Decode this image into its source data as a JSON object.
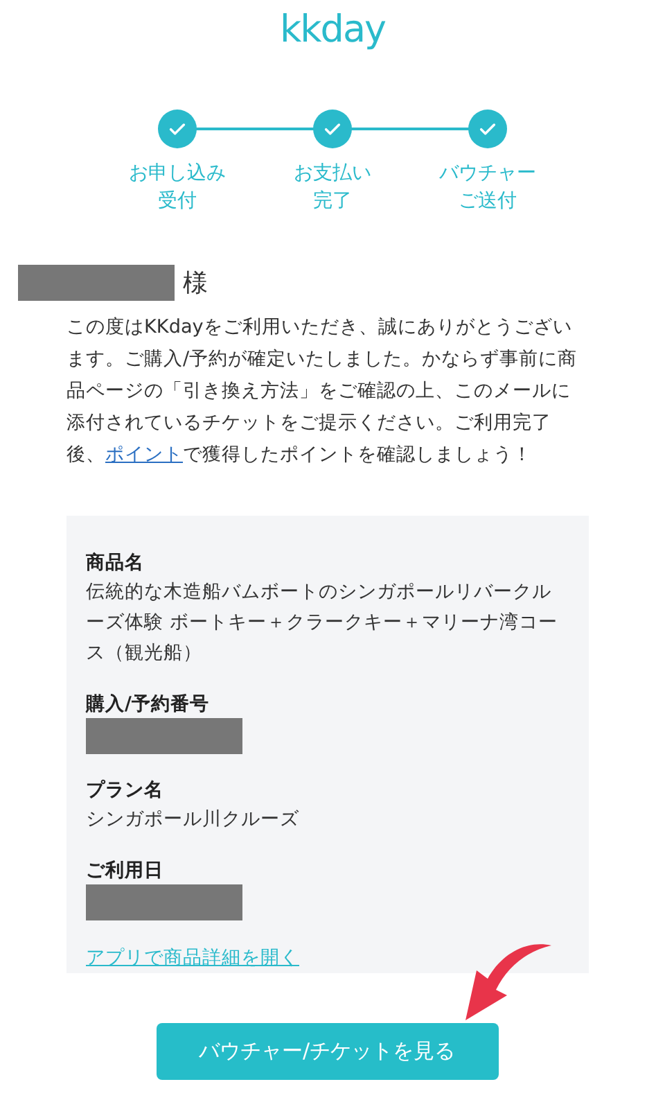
{
  "logo": "kkday",
  "steps": [
    {
      "lines": [
        "お申し込み",
        "受付"
      ],
      "done": true
    },
    {
      "lines": [
        "お支払い",
        "完了"
      ],
      "done": true
    },
    {
      "lines": [
        "バウチャー",
        "ご送付"
      ],
      "done": true
    }
  ],
  "greeting": {
    "name_redacted": true,
    "honorific": "様"
  },
  "message": {
    "before": "この度はKKdayをご利用いただき、誠にありがとうございます。ご購入/予約が確定いたしました。かならず事前に商品ページの「引き換え方法」をご確認の上、このメールに添付されているチケットをご提示ください。ご利用完了後、",
    "link": "ポイント",
    "after": "で獲得したポイントを確認しましょう！"
  },
  "details": [
    {
      "label": "商品名",
      "value": "伝統的な木造船バムボートのシンガポールリバークルーズ体験 ボートキー＋クラークキー＋マリーナ湾コース（観光船）",
      "redacted": false
    },
    {
      "label": "購入/予約番号",
      "redacted": true
    },
    {
      "label": "プラン名",
      "value": "シンガポール川クルーズ",
      "redacted": false
    },
    {
      "label": "ご利用日",
      "redacted": true
    }
  ],
  "app_link": "アプリで商品詳細を開く",
  "button": "バウチャー/チケットを見る"
}
